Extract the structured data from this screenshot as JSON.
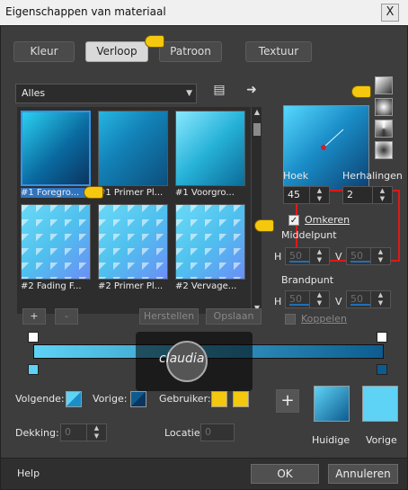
{
  "window": {
    "title": "Eigenschappen van materiaal",
    "close": "X"
  },
  "tabs": [
    {
      "label": "Kleur"
    },
    {
      "label": "Verloop"
    },
    {
      "label": "Patroon"
    },
    {
      "label": "Textuur"
    }
  ],
  "filter": {
    "value": "Alles"
  },
  "gradients": [
    {
      "label": "#1 Foregro..."
    },
    {
      "label": "#1 Primer Pl..."
    },
    {
      "label": "#1 Voorgro..."
    },
    {
      "label": "#2 Fading F..."
    },
    {
      "label": "#2 Primer Pl..."
    },
    {
      "label": "#2 Vervage..."
    }
  ],
  "actions": {
    "add": "+",
    "remove": "-",
    "restore": "Herstellen",
    "save": "Opslaan"
  },
  "settings": {
    "angle_label": "Hoek",
    "angle_value": "45",
    "repeats_label": "Herhalingen",
    "repeats_value": "2",
    "invert_label": "Omkeren",
    "center_label": "Middelpunt",
    "h_label": "H",
    "v_label": "V",
    "center_h": "50",
    "center_v": "50",
    "focal_label": "Brandpunt",
    "focal_h": "50",
    "focal_v": "50",
    "link_label": "Koppelen"
  },
  "colors": {
    "next_label": "Volgende:",
    "prev_label": "Vorige:",
    "user_label": "Gebruiker:",
    "opacity_label": "Dekking:",
    "opacity_value": "0",
    "location_label": "Locatie:",
    "location_value": "0",
    "current_label": "Huidige",
    "previous_label": "Vorige",
    "add_button": "+"
  },
  "watermark": {
    "text": "claudia"
  },
  "footer": {
    "help": "Help",
    "ok": "OK",
    "cancel": "Annuleren"
  }
}
